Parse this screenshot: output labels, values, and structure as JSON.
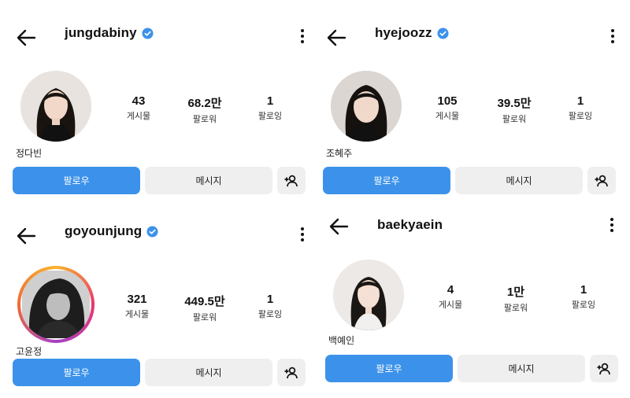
{
  "profiles": [
    {
      "username": "jungdabiny",
      "verified": true,
      "real_name": "정다빈",
      "posts": "43",
      "posts_label": "게시물",
      "followers": "68.2만",
      "followers_label": "팔로워",
      "following": "1",
      "following_label": "팔로잉",
      "follow_label": "팔로우",
      "message_label": "메시지",
      "story_ring": false
    },
    {
      "username": "hyejoozz",
      "verified": true,
      "real_name": "조혜주",
      "posts": "105",
      "posts_label": "게시물",
      "followers": "39.5만",
      "followers_label": "팔로워",
      "following": "1",
      "following_label": "팔로잉",
      "follow_label": "팔로우",
      "message_label": "메시지",
      "story_ring": false
    },
    {
      "username": "goyounjung",
      "verified": true,
      "real_name": "고윤정",
      "posts": "321",
      "posts_label": "게시물",
      "followers": "449.5만",
      "followers_label": "팔로워",
      "following": "1",
      "following_label": "팔로잉",
      "follow_label": "팔로우",
      "message_label": "메시지",
      "story_ring": true
    },
    {
      "username": "baekyaein",
      "verified": false,
      "real_name": "백예인",
      "posts": "4",
      "posts_label": "게시물",
      "followers": "1만",
      "followers_label": "팔로워",
      "following": "1",
      "following_label": "팔로잉",
      "follow_label": "팔로우",
      "message_label": "메시지",
      "story_ring": false
    }
  ],
  "colors": {
    "accent": "#3c92ea",
    "verified": "#3c92ea",
    "secondary_button": "#efefef"
  },
  "icons": [
    "back-arrow-icon",
    "verified-badge-icon",
    "more-options-icon",
    "add-person-icon"
  ]
}
